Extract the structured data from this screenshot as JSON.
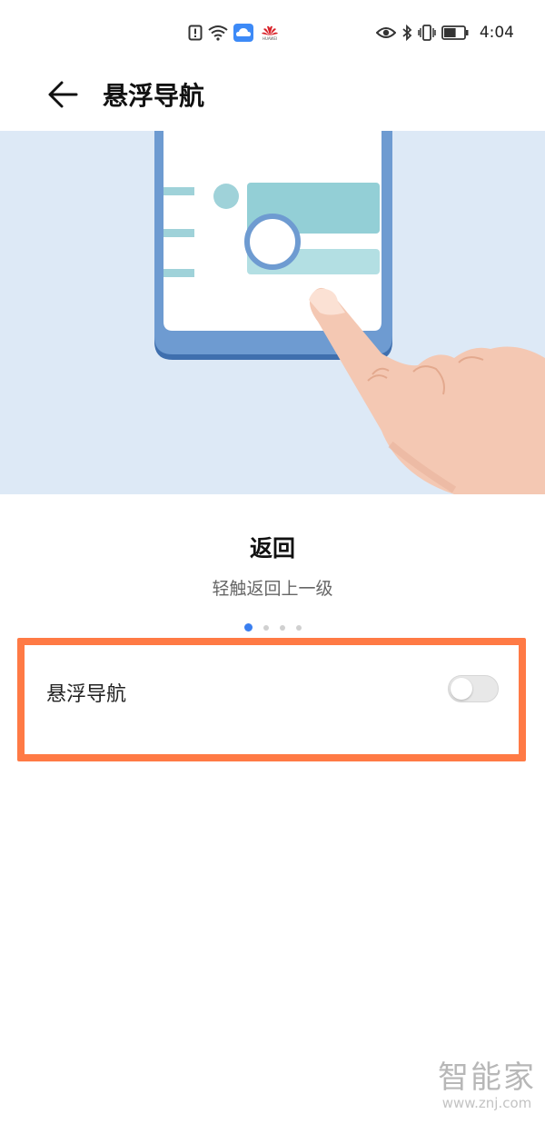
{
  "status_bar": {
    "icons_center": [
      "warning-icon",
      "wifi-icon",
      "cloud-icon",
      "huawei-logo"
    ],
    "huawei_text": "HUAWEI",
    "icons_right": [
      "eye-icon",
      "bluetooth-icon",
      "vibrate-icon",
      "battery-icon"
    ],
    "time": "4:04",
    "battery_level": 0.6
  },
  "header": {
    "title": "悬浮导航",
    "back_icon": "arrow-left-icon"
  },
  "slide": {
    "title": "返回",
    "description": "轻触返回上一级"
  },
  "pager": {
    "current_index": 0,
    "count": 4,
    "active_color": "#3a7ff0"
  },
  "setting": {
    "label": "悬浮导航",
    "enabled": false
  },
  "highlight_color": "#ff7a45",
  "illustration_bg": "#dde9f6",
  "watermark": {
    "logo_text": "智能家",
    "url": "www.znj.com"
  }
}
